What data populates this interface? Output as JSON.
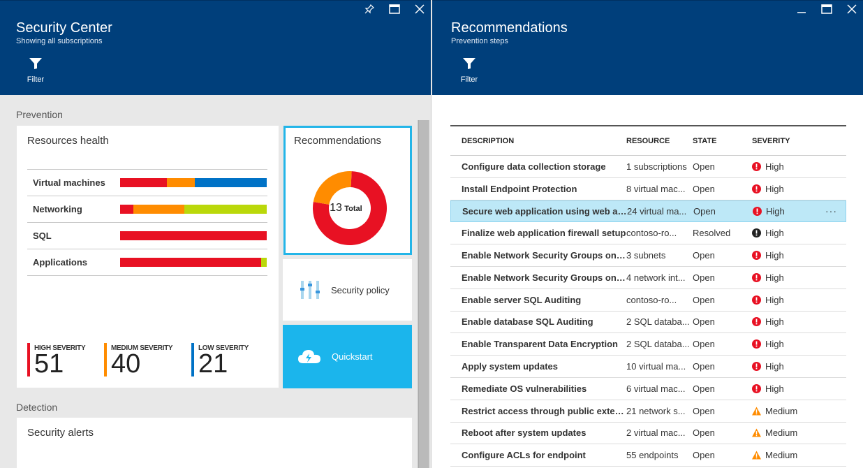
{
  "left_blade": {
    "title": "Security Center",
    "subtitle": "Showing all subscriptions",
    "filter_label": "Filter",
    "prevention_label": "Prevention",
    "detection_label": "Detection",
    "resources_health": {
      "title": "Resources health",
      "rows": [
        {
          "name": "Virtual machines",
          "segments": [
            {
              "color": "#e81123",
              "fraction": 0.32
            },
            {
              "color": "#ff8c00",
              "fraction": 0.19
            },
            {
              "color": "#0072c6",
              "fraction": 0.49
            }
          ]
        },
        {
          "name": "Networking",
          "segments": [
            {
              "color": "#e81123",
              "fraction": 0.09
            },
            {
              "color": "#ff8c00",
              "fraction": 0.35
            },
            {
              "color": "#bad80a",
              "fraction": 0.56
            }
          ]
        },
        {
          "name": "SQL",
          "segments": [
            {
              "color": "#e81123",
              "fraction": 1.0
            }
          ]
        },
        {
          "name": "Applications",
          "segments": [
            {
              "color": "#e81123",
              "fraction": 0.96
            },
            {
              "color": "#bad80a",
              "fraction": 0.04
            }
          ]
        }
      ],
      "severity": [
        {
          "label": "HIGH SEVERITY",
          "count": "51",
          "color": "#e81123"
        },
        {
          "label": "MEDIUM SEVERITY",
          "count": "40",
          "color": "#ff8c00"
        },
        {
          "label": "LOW SEVERITY",
          "count": "21",
          "color": "#0072c6"
        }
      ]
    },
    "recommendations_tile": {
      "title": "Recommendations",
      "total_number": "13",
      "total_label": "Total",
      "slices": [
        {
          "color": "#e81123",
          "value": 10
        },
        {
          "color": "#ff8c00",
          "value": 3
        }
      ]
    },
    "security_policy_label": "Security policy",
    "quickstart_label": "Quickstart",
    "security_alerts_title": "Security alerts"
  },
  "right_blade": {
    "title": "Recommendations",
    "subtitle": "Prevention steps",
    "filter_label": "Filter",
    "columns": [
      "DESCRIPTION",
      "RESOURCE",
      "STATE",
      "SEVERITY"
    ],
    "rows": [
      {
        "description": "Configure data collection storage",
        "resource": "1 subscriptions",
        "state": "Open",
        "severity": "High",
        "icon": "high-error-icon"
      },
      {
        "description": "Install Endpoint Protection",
        "resource": "8 virtual mac...",
        "state": "Open",
        "severity": "High",
        "icon": "high-error-icon"
      },
      {
        "description": "Secure web application using web appli...",
        "resource": "24 virtual ma...",
        "state": "Open",
        "severity": "High",
        "icon": "high-error-icon",
        "selected": true,
        "more": "···"
      },
      {
        "description": "Finalize web application firewall setup",
        "resource": "contoso-ro...",
        "state": "Resolved",
        "severity": "High",
        "icon": "high-resolved-icon"
      },
      {
        "description": "Enable Network Security Groups on sub...",
        "resource": "3 subnets",
        "state": "Open",
        "severity": "High",
        "icon": "high-error-icon"
      },
      {
        "description": "Enable Network Security Groups on net...",
        "resource": "4 network int...",
        "state": "Open",
        "severity": "High",
        "icon": "high-error-icon"
      },
      {
        "description": "Enable server SQL Auditing",
        "resource": "contoso-ro...",
        "state": "Open",
        "severity": "High",
        "icon": "high-error-icon"
      },
      {
        "description": "Enable database SQL Auditing",
        "resource": "2 SQL databa...",
        "state": "Open",
        "severity": "High",
        "icon": "high-error-icon"
      },
      {
        "description": "Enable Transparent Data Encryption",
        "resource": "2 SQL databa...",
        "state": "Open",
        "severity": "High",
        "icon": "high-error-icon"
      },
      {
        "description": "Apply system updates",
        "resource": "10 virtual ma...",
        "state": "Open",
        "severity": "High",
        "icon": "high-error-icon"
      },
      {
        "description": "Remediate OS vulnerabilities",
        "resource": "6 virtual mac...",
        "state": "Open",
        "severity": "High",
        "icon": "high-error-icon"
      },
      {
        "description": "Restrict access through public external...",
        "resource": "21 network s...",
        "state": "Open",
        "severity": "Medium",
        "icon": "medium-warning-icon"
      },
      {
        "description": "Reboot after system updates",
        "resource": "2 virtual mac...",
        "state": "Open",
        "severity": "Medium",
        "icon": "medium-warning-icon"
      },
      {
        "description": "Configure ACLs for endpoint",
        "resource": "55 endpoints",
        "state": "Open",
        "severity": "Medium",
        "icon": "medium-warning-icon"
      }
    ]
  },
  "colors": {
    "header_bg": "#003f7b",
    "accent": "#1bb5ec",
    "high": "#e81123",
    "medium": "#ff8c00",
    "low": "#0072c6"
  }
}
